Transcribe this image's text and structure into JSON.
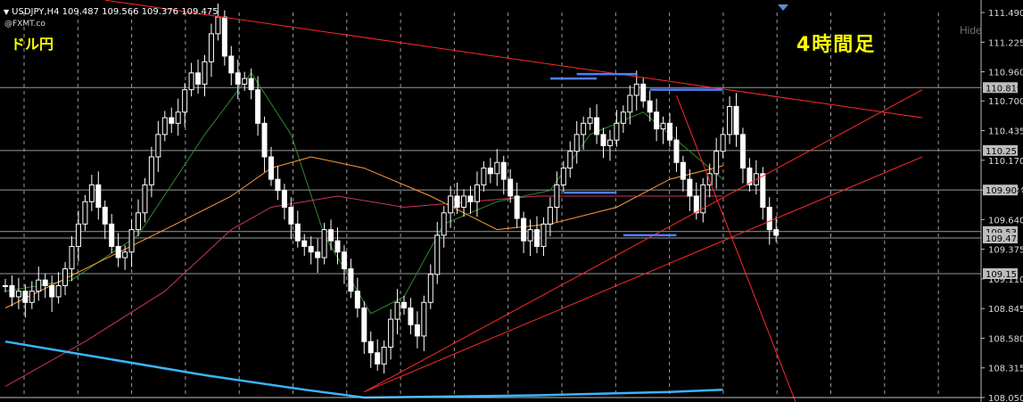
{
  "header": {
    "symbol_line": "USDJPY,H4 109.487 109.566 109.376 109.475",
    "copyright": "@FXMT.co",
    "pair_label": "ドル円",
    "timeframe_label": "4時間足",
    "hide_label": "Hide"
  },
  "colors": {
    "background": "#000000",
    "candle": "#ffffff",
    "grid": "#9a9a9a",
    "trend": "#ff2a2a",
    "ma_short": "#2e8b2e",
    "ma_mid": "#ff9a3c",
    "ma_long": "#cc3366",
    "ma_blue": "#38b6ff",
    "level_marker": "#4f7dff"
  },
  "chart_data": {
    "type": "candlestick",
    "symbol": "USDJPY",
    "timeframe": "H4",
    "ohlc_last": {
      "open": 109.487,
      "high": 109.566,
      "low": 109.376,
      "close": 109.475
    },
    "ylim": [
      108.05,
      111.6
    ],
    "price_ticks": [
      111.49,
      111.225,
      110.96,
      110.7,
      110.435,
      110.17,
      109.904,
      109.64,
      109.375,
      109.11,
      108.845,
      108.58,
      108.315,
      108.05
    ],
    "horizontal_levels": [
      110.819,
      110.257,
      109.904,
      109.533,
      109.475,
      109.157
    ],
    "highlighted_levels": [
      110.819,
      110.257,
      109.904,
      109.533,
      109.475,
      109.157
    ],
    "closes": [
      109.05,
      108.95,
      109.0,
      108.9,
      109.0,
      109.1,
      109.05,
      108.95,
      109.05,
      109.2,
      109.4,
      109.6,
      109.8,
      109.95,
      109.75,
      109.6,
      109.4,
      109.3,
      109.35,
      109.55,
      109.7,
      109.95,
      110.2,
      110.4,
      110.55,
      110.5,
      110.6,
      110.8,
      110.95,
      110.85,
      111.05,
      111.3,
      111.45,
      111.1,
      110.95,
      110.85,
      110.9,
      110.8,
      110.5,
      110.2,
      110.0,
      109.9,
      109.75,
      109.6,
      109.45,
      109.4,
      109.35,
      109.3,
      109.55,
      109.45,
      109.35,
      109.2,
      109.0,
      108.85,
      108.55,
      108.45,
      108.35,
      108.5,
      108.75,
      108.9,
      108.85,
      108.7,
      108.6,
      108.9,
      109.15,
      109.5,
      109.7,
      109.85,
      109.75,
      109.85,
      109.8,
      109.95,
      110.1,
      110.05,
      110.15,
      110.0,
      109.85,
      109.65,
      109.45,
      109.55,
      109.4,
      109.6,
      109.75,
      109.95,
      110.1,
      110.25,
      110.4,
      110.5,
      110.55,
      110.4,
      110.3,
      110.35,
      110.5,
      110.6,
      110.75,
      110.85,
      110.7,
      110.6,
      110.45,
      110.5,
      110.35,
      110.15,
      110.0,
      109.85,
      109.7,
      109.95,
      110.05,
      110.25,
      110.4,
      110.65,
      110.4,
      110.1,
      109.95,
      110.05,
      109.75,
      109.55,
      109.5
    ],
    "trendlines": [
      {
        "from": [
          15,
          111.6
        ],
        "to": [
          138,
          110.55
        ]
      },
      {
        "from": [
          54,
          108.1
        ],
        "to": [
          138,
          110.8
        ]
      },
      {
        "from": [
          54,
          108.1
        ],
        "to": [
          138,
          110.2
        ]
      },
      {
        "from": [
          101,
          110.75
        ],
        "to": [
          119,
          108.0
        ]
      }
    ],
    "level_markers": [
      {
        "price": 110.9,
        "x1": 82,
        "x2": 89
      },
      {
        "price": 110.94,
        "x1": 86,
        "x2": 95
      },
      {
        "price": 110.8,
        "x1": 97,
        "x2": 108
      },
      {
        "price": 109.88,
        "x1": 84,
        "x2": 92
      },
      {
        "price": 109.5,
        "x1": 93,
        "x2": 101
      }
    ],
    "moving_averages": [
      {
        "id": "ma_short",
        "points": [
          [
            0,
            109.0
          ],
          [
            10,
            109.1
          ],
          [
            20,
            109.5
          ],
          [
            30,
            110.4
          ],
          [
            37,
            110.95
          ],
          [
            43,
            110.4
          ],
          [
            48,
            109.5
          ],
          [
            55,
            108.8
          ],
          [
            60,
            108.95
          ],
          [
            66,
            109.6
          ],
          [
            74,
            109.8
          ],
          [
            82,
            109.9
          ],
          [
            88,
            110.4
          ],
          [
            96,
            110.6
          ],
          [
            104,
            110.2
          ],
          [
            108,
            110.0
          ]
        ]
      },
      {
        "id": "ma_mid",
        "points": [
          [
            0,
            108.85
          ],
          [
            12,
            109.2
          ],
          [
            24,
            109.55
          ],
          [
            34,
            109.85
          ],
          [
            40,
            110.1
          ],
          [
            46,
            110.2
          ],
          [
            54,
            110.1
          ],
          [
            64,
            109.85
          ],
          [
            74,
            109.55
          ],
          [
            82,
            109.6
          ],
          [
            92,
            109.75
          ],
          [
            100,
            110.0
          ],
          [
            108,
            110.12
          ]
        ]
      },
      {
        "id": "ma_long",
        "points": [
          [
            0,
            108.15
          ],
          [
            12,
            108.55
          ],
          [
            24,
            109.0
          ],
          [
            34,
            109.55
          ],
          [
            40,
            109.75
          ],
          [
            50,
            109.85
          ],
          [
            60,
            109.75
          ],
          [
            70,
            109.8
          ],
          [
            80,
            109.85
          ],
          [
            90,
            109.85
          ],
          [
            100,
            109.85
          ],
          [
            108,
            109.85
          ]
        ]
      },
      {
        "id": "ma_blue",
        "points": [
          [
            0,
            108.55
          ],
          [
            15,
            108.4
          ],
          [
            30,
            108.25
          ],
          [
            45,
            108.12
          ],
          [
            54,
            108.05
          ],
          [
            80,
            108.07
          ],
          [
            100,
            108.1
          ],
          [
            108,
            108.12
          ]
        ]
      }
    ]
  }
}
